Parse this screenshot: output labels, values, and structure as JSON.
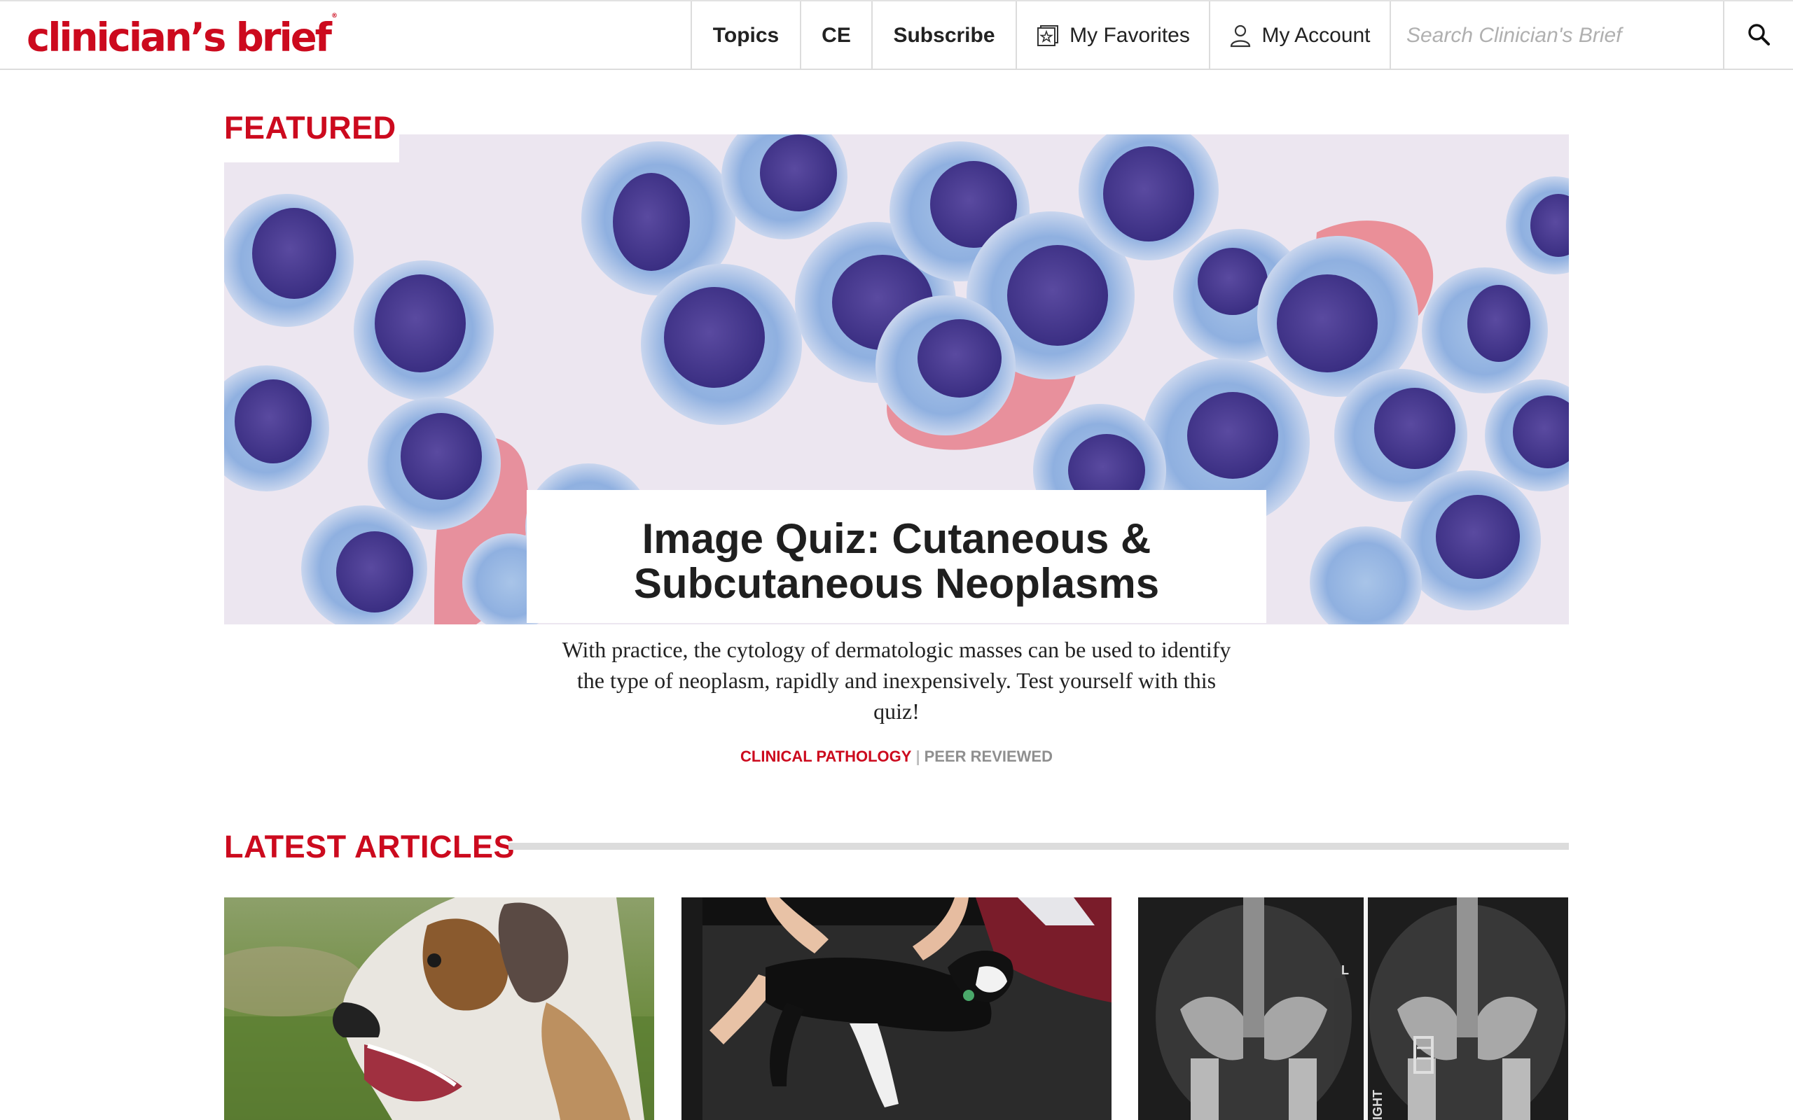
{
  "header": {
    "logo_text": "clinician’s brief",
    "nav": {
      "topics": "Topics",
      "ce": "CE",
      "subscribe": "Subscribe",
      "favorites": "My Favorites",
      "account": "My Account"
    },
    "search_placeholder": "Search Clinician's Brief"
  },
  "featured": {
    "section_label": "FEATURED",
    "title": "Image Quiz: Cutaneous & Subcutaneous Neoplasms",
    "description": "With practice, the cytology of dermatologic masses can be used to identify the type of neoplasm, rapidly and inexpensively. Test yourself with this quiz!",
    "tag_primary": "CLINICAL PATHOLOGY",
    "tag_secondary": "PEER REVIEWED"
  },
  "latest": {
    "section_label": "LATEST ARTICLES",
    "cards": [
      {
        "image": "australian-shepherd-dog-photo"
      },
      {
        "image": "dog-physical-exam-photo"
      },
      {
        "image": "pelvis-radiograph-photo",
        "overlay_text_1": "L",
        "overlay_text_2": "IGHT"
      }
    ]
  },
  "colors": {
    "brand_red": "#cc0a1e",
    "text_dark": "#222222",
    "tag_grey": "#8f8f8f",
    "rule_grey": "#dcdcdc"
  }
}
